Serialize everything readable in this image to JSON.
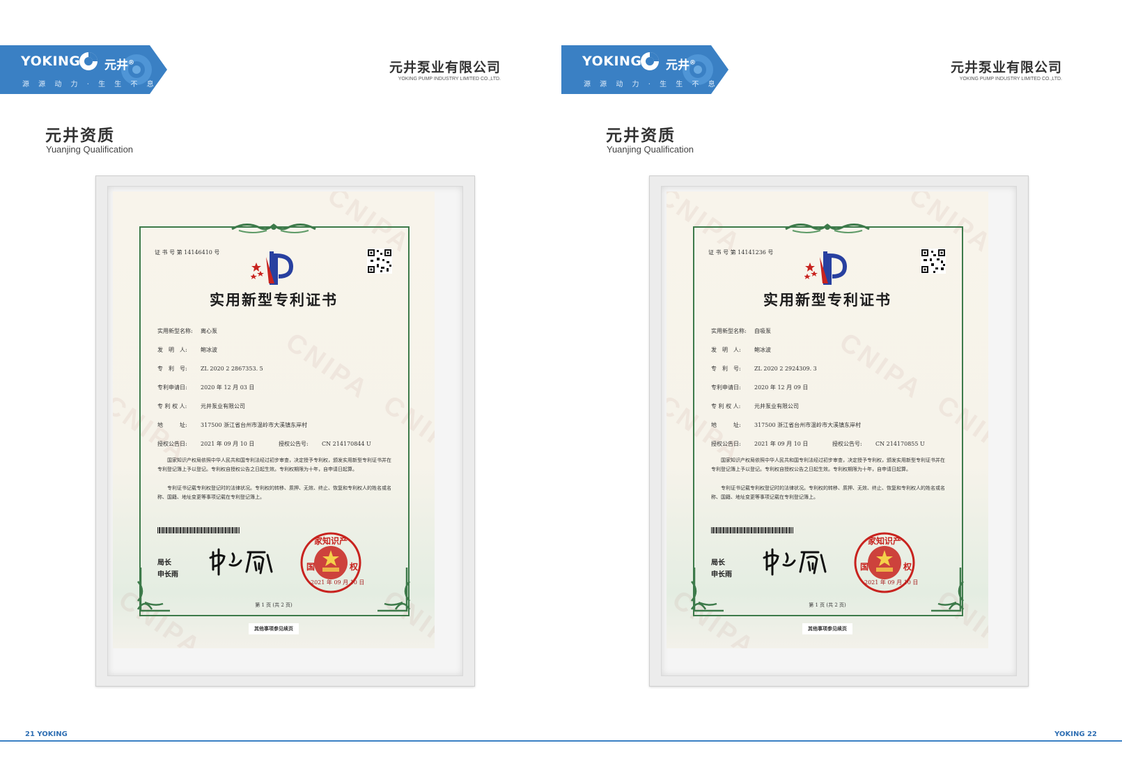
{
  "brand": {
    "name": "YOKING",
    "name_cn": "元井",
    "registered": "®",
    "slogan": "源 源 动 力 · 生 生 不 息"
  },
  "company": {
    "name_cn": "元井泵业有限公司",
    "name_en": "YOKING PUMP INDUSTRY LIMITED CO.,LTD."
  },
  "section": {
    "title": "元井资质",
    "subtitle": "Yuanjing Qualification"
  },
  "colors": {
    "brand_blue": "#3a80c4",
    "cert_green": "#3d7a4a",
    "seal_red": "#c8231f"
  },
  "pages": [
    {
      "page_number": "21 YOKING",
      "certificate": {
        "cert_no": "证 书 号 第 14146410 号",
        "title": "实用新型专利证书",
        "fields": [
          {
            "label": "实用新型名称:",
            "value": "离心泵"
          },
          {
            "label": "发　明　人:",
            "value": "鲍冰波"
          },
          {
            "label": "专　利　号:",
            "value": "ZL 2020 2 2867353. 5"
          },
          {
            "label": "专利申请日:",
            "value": "2020 年 12 月 03 日"
          },
          {
            "label": "专 利 权 人:",
            "value": "元井泵业有限公司"
          },
          {
            "label": "地　　　址:",
            "value": "317500  浙江省台州市温岭市大溪镇东岸村"
          },
          {
            "label": "授权公告日:",
            "value": "2021 年 09 月 10 日",
            "label2": "授权公告号:",
            "value2": "CN 214170844 U"
          }
        ],
        "paragraph1": "国家知识产权局依照中华人民共和国专利法经过初步审查，决定授予专利权，颁发实用新型专利证书并在专利登记簿上予以登记。专利权自授权公告之日起生效。专利权期限为十年，自申请日起算。",
        "paragraph2": "专利证书记载专利权登记时的法律状况。专利权的转移、质押、无效、终止、恢复和专利权人的姓名或名称、国籍、地址变更等事项记载在专利登记簿上。",
        "signer_title": "局长",
        "signer_name": "申长雨",
        "seal_date": "2021 年 09 月 10 日",
        "page_note": "第 1 页 (共 2 页)",
        "foot_note": "其他事项参见续页",
        "watermark": "CNIPA"
      }
    },
    {
      "page_number": "YOKING 22",
      "certificate": {
        "cert_no": "证 书 号 第 14141236 号",
        "title": "实用新型专利证书",
        "fields": [
          {
            "label": "实用新型名称:",
            "value": "自吸泵"
          },
          {
            "label": "发　明　人:",
            "value": "鲍冰波"
          },
          {
            "label": "专　利　号:",
            "value": "ZL 2020 2 2924309. 3"
          },
          {
            "label": "专利申请日:",
            "value": "2020 年 12 月 09 日"
          },
          {
            "label": "专 利 权 人:",
            "value": "元井泵业有限公司"
          },
          {
            "label": "地　　　址:",
            "value": "317500  浙江省台州市温岭市大溪镇东岸村"
          },
          {
            "label": "授权公告日:",
            "value": "2021 年 09 月 10 日",
            "label2": "授权公告号:",
            "value2": "CN 214170855 U"
          }
        ],
        "paragraph1": "国家知识产权局依照中华人民共和国专利法经过初步审查，决定授予专利权，颁发实用新型专利证书并在专利登记簿上予以登记。专利权自授权公告之日起生效。专利权期限为十年，自申请日起算。",
        "paragraph2": "专利证书记载专利权登记时的法律状况。专利权的转移、质押、无效、终止、恢复和专利权人的姓名或名称、国籍、地址变更等事项记载在专利登记簿上。",
        "signer_title": "局长",
        "signer_name": "申长雨",
        "seal_date": "2021 年 09 月 10 日",
        "page_note": "第 1 页 (共 2 页)",
        "foot_note": "其他事项参见续页",
        "watermark": "CNIPA"
      }
    }
  ]
}
